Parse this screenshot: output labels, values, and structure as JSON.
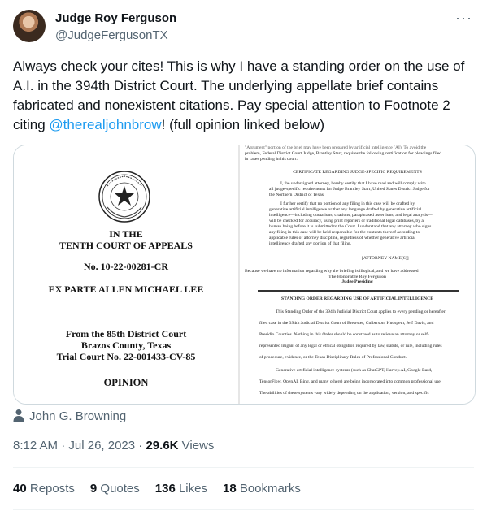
{
  "author": {
    "name": "Judge Roy Ferguson",
    "handle": "@JudgeFergusonTX"
  },
  "tweet": {
    "text_before": "Always check your cites! This is why I have a standing order on the use of A.I. in the 394th District Court. The underlying appellate brief contains fabricated and nonexistent citations. Pay special attention to Footnote 2 citing ",
    "mention": "@therealjohnbrow",
    "text_after": "! (full opinion linked below)"
  },
  "image_left": {
    "heading1": "IN THE",
    "heading2": "TENTH COURT OF APPEALS",
    "case_no": "No. 10-22-00281-CR",
    "case_name": "EX PARTE ALLEN MICHAEL LEE",
    "from1": "From the 85th District Court",
    "from2": "Brazos County, Texas",
    "from3": "Trial Court No. 22-001433-CV-85",
    "opinion": "OPINION"
  },
  "image_right": {
    "l1": "\"Argument\" portion of the brief may have been prepared by artificial intelligence (AI). To avoid the",
    "l2": "problem, Federal District Court Judge, Brantley Starr, requires the following certification for pleadings filed",
    "l3": "in cases pending in his court:",
    "cert_title": "CERTIFICATE REGARDING JUDGE-SPECIFIC REQUIREMENTS",
    "c1": "I, the undersigned attorney, hereby certify that I have read and will comply with",
    "c2": "all judge-specific requirements for Judge Brantley Starr, United States District Judge for",
    "c3": "the Northern District of Texas.",
    "c4": "I further certify that no portion of any filing in this case will be drafted by",
    "c5": "generative artificial intelligence or that any language drafted by generative artificial",
    "c6": "intelligence—including quotations, citations, paraphrased assertions, and legal analysis—",
    "c7": "will be checked for accuracy, using print reporters or traditional legal databases, by a",
    "c8": "human being before it is submitted to the Court. I understand that any attorney who signs",
    "c9": "any filing in this case will be held responsible for the contents thereof according to",
    "c10": "applicable rules of attorney discipline, regardless of whether generative artificial",
    "c11": "intelligence drafted any portion of that filing.",
    "attorney": "[ATTORNEY NAME(S)]",
    "b1": "Because we have no information regarding why the briefing is illogical, and we have addressed",
    "overlap": "The Honorable Roy Ferguson",
    "presiding": "Judge Presiding",
    "order_title": "STANDING ORDER REGARDING USE OF ARTIFICIAL INTELLIGENCE",
    "o1": "This Standing Order of the 394th Judicial District Court applies to every pending or hereafter",
    "o2": "filed case in the 394th Judicial District Court of Brewster, Culberson, Hudspeth, Jeff Davis, and",
    "o3": "Presidio Counties. Nothing in this Order should be construed as to relieve an attorney or self-",
    "o4": "represented litigant of any legal or ethical obligation required by law, statute, or rule, including rules",
    "o5": "of procedure, evidence, or the Texas Disciplinary Rules of Professional Conduct.",
    "o6": "Generative artificial intelligence systems (such as ChatGPT, Harvey.AI, Google Bard,",
    "o7": "TensorFlow, OpenAI, Bing, and many others) are being incorporated into common professional use.",
    "o8": "The abilities of these systems vary widely depending on the application, version, and specific"
  },
  "credit": "John G. Browning",
  "meta": {
    "time": "8:12 AM",
    "sep": " · ",
    "date": "Jul 26, 2023",
    "views_count": "29.6K",
    "views_label": " Views"
  },
  "stats": {
    "reposts_count": "40",
    "reposts_label": " Reposts",
    "quotes_count": "9",
    "quotes_label": " Quotes",
    "likes_count": "136",
    "likes_label": " Likes",
    "bookmarks_count": "18",
    "bookmarks_label": " Bookmarks"
  },
  "icons": {
    "more": "more-icon",
    "person": "person-icon",
    "seal": "texas-seal-icon"
  }
}
